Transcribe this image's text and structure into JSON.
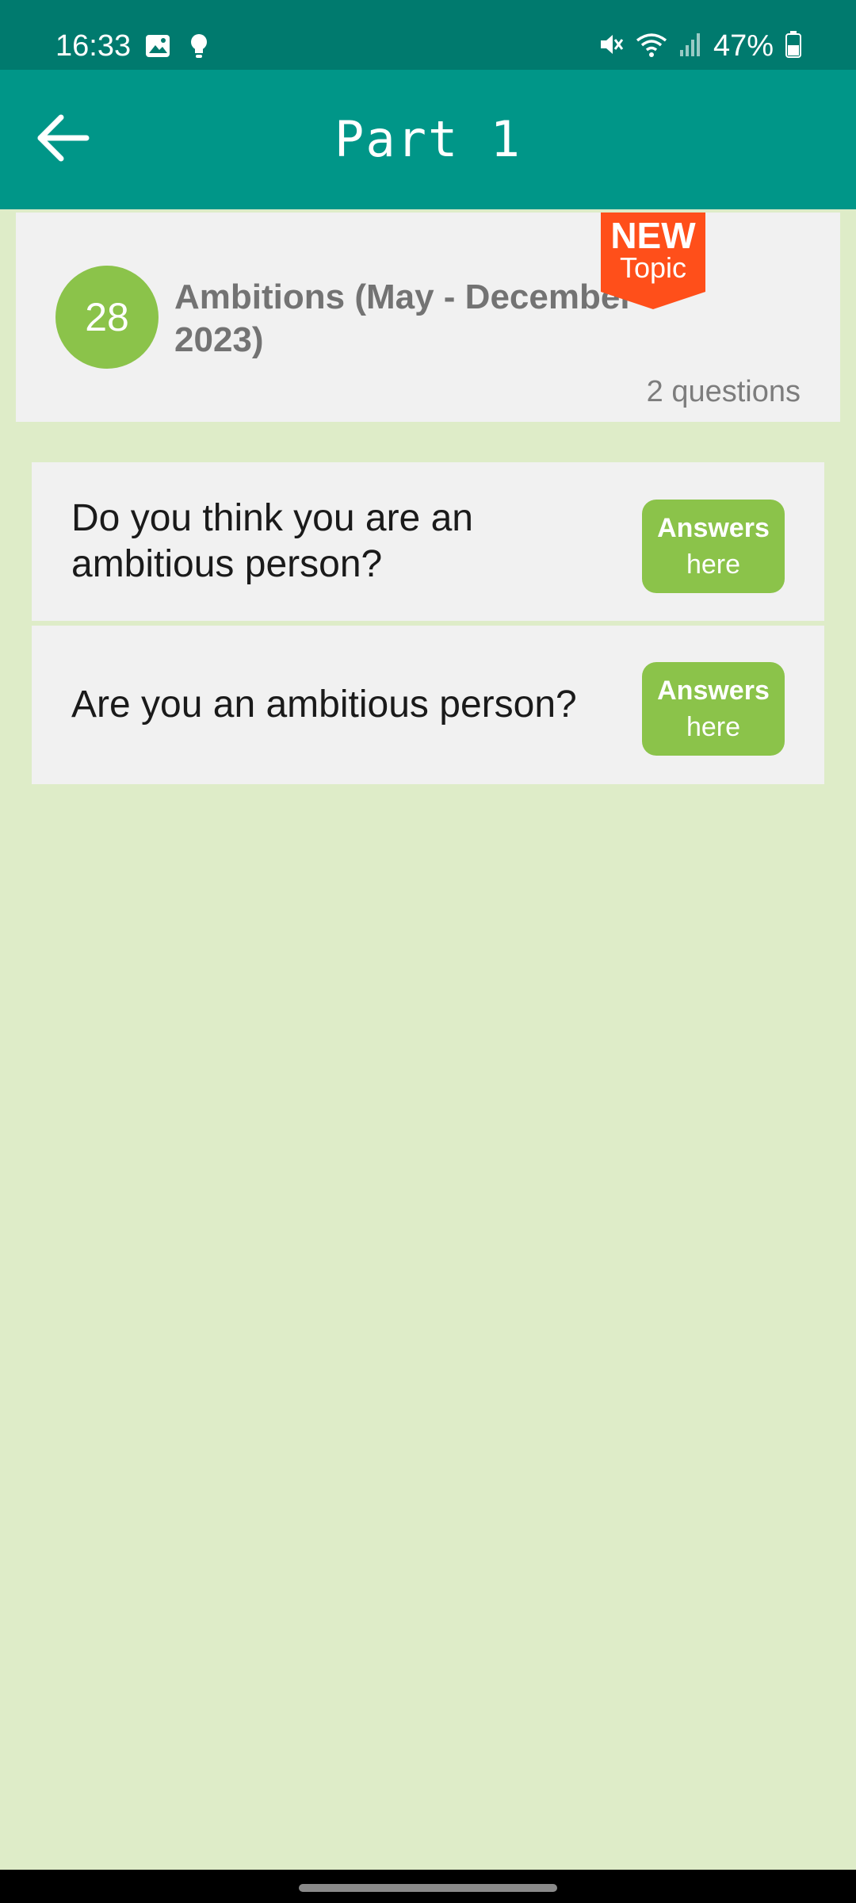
{
  "status_bar": {
    "time": "16:33",
    "battery": "47%",
    "icons": [
      "image-icon",
      "bulb-icon",
      "mute-icon",
      "wifi-icon",
      "signal-icon",
      "battery-icon"
    ]
  },
  "app_bar": {
    "title": "Part 1",
    "back_icon": "arrow-left-icon"
  },
  "topic": {
    "number": "28",
    "title": "Ambitions (May - December 2023)",
    "question_count": "2 questions",
    "badge": {
      "label": "NEW",
      "sub": "Topic",
      "color": "#ff4f1a"
    }
  },
  "questions": [
    {
      "text": "Do you think you are an ambitious person?",
      "button_main": "Answers",
      "button_sub": "here"
    },
    {
      "text": "Are you an ambitious person?",
      "button_main": "Answers",
      "button_sub": "here"
    }
  ],
  "colors": {
    "status_bar": "#007a6e",
    "app_bar": "#009688",
    "background": "#deecc8",
    "accent": "#8bc34a",
    "card": "#f1f1f1"
  }
}
